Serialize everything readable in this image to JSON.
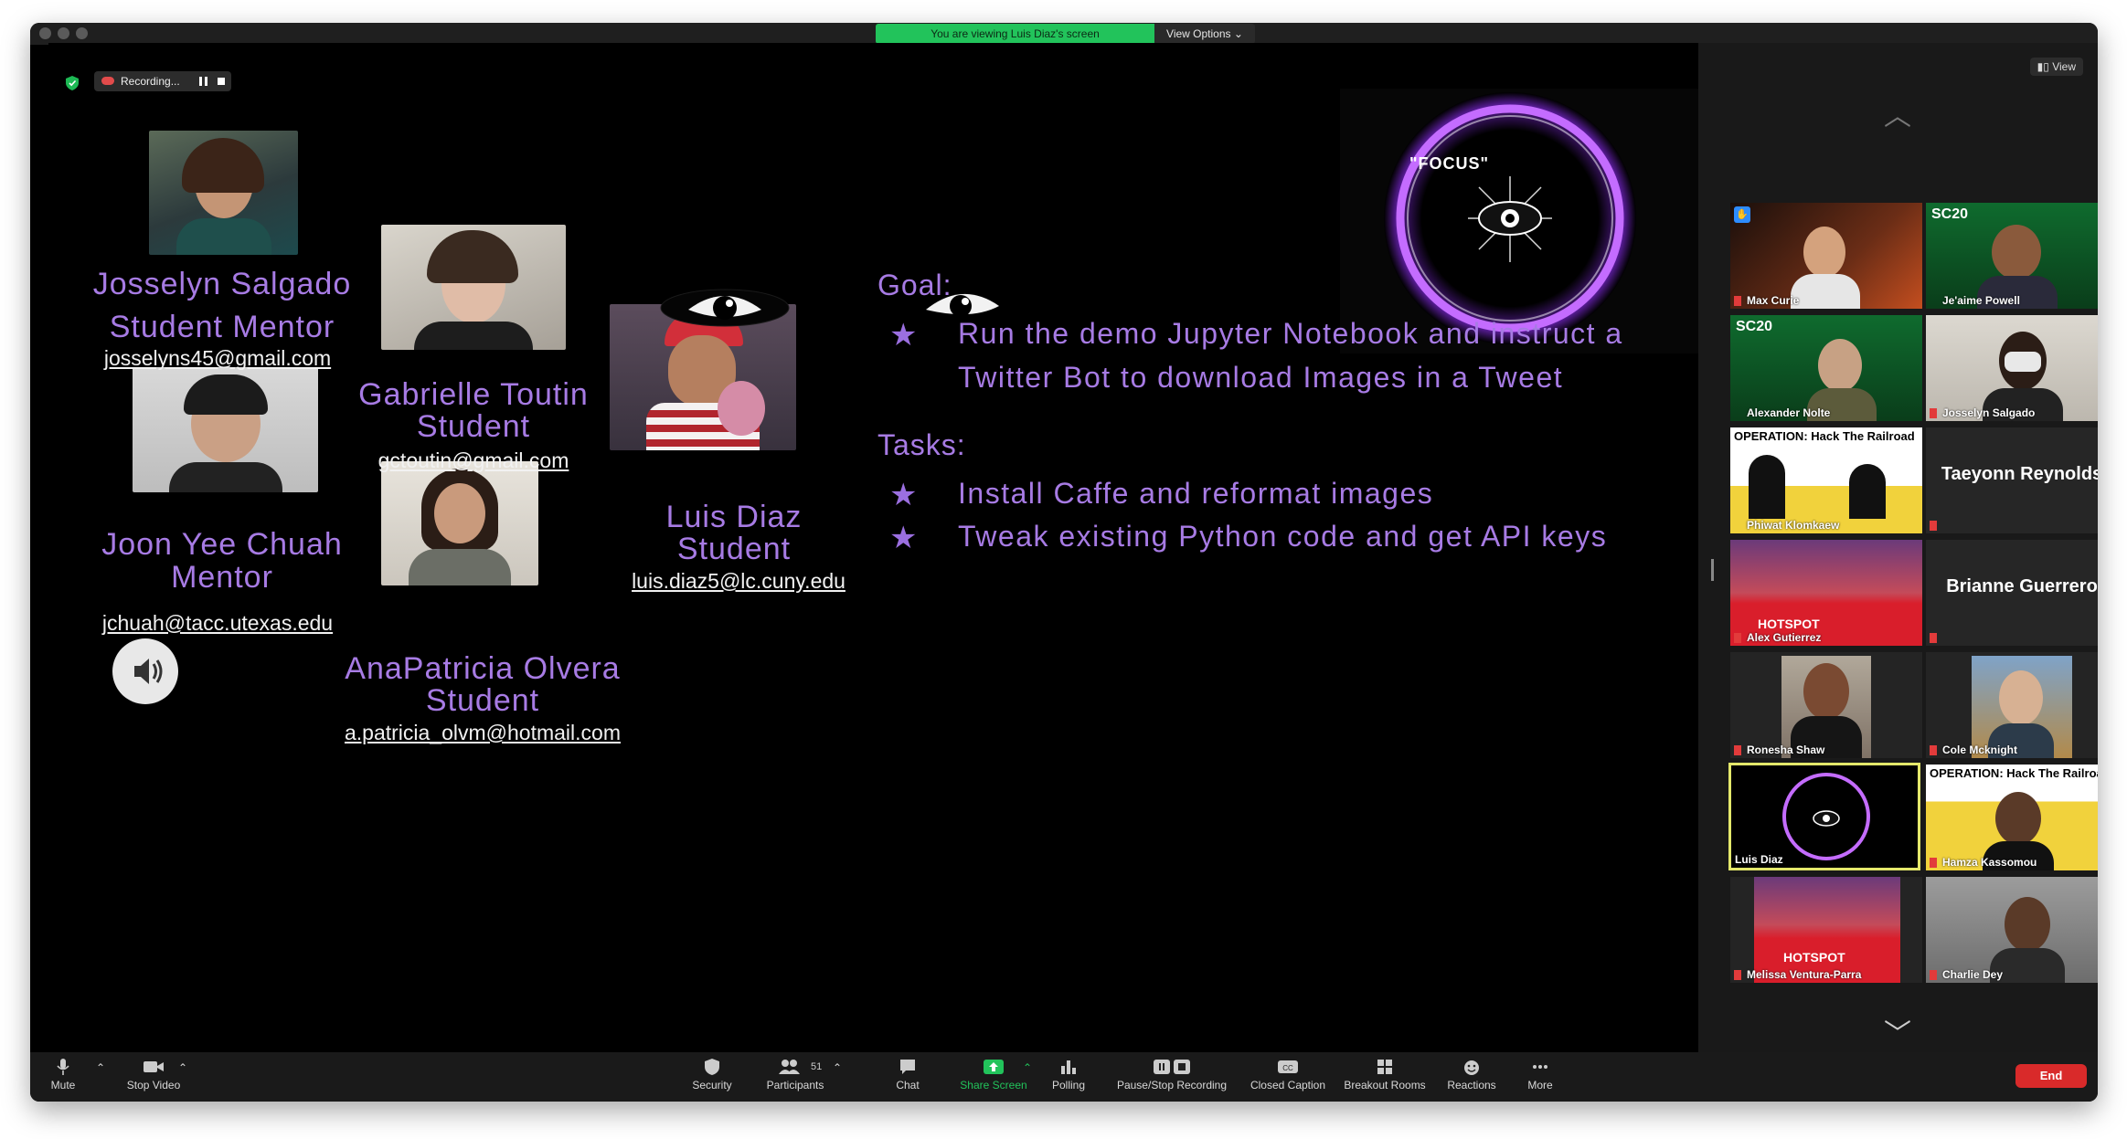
{
  "banner": {
    "viewing": "You are viewing Luis Diaz's screen",
    "view_options": "View Options"
  },
  "recording": {
    "label": "Recording..."
  },
  "view_button": "View",
  "slide": {
    "people": [
      {
        "name": "Josselyn Salgado",
        "role": "Student Mentor",
        "email": "josselyns45@gmail.com"
      },
      {
        "name": "Gabrielle Toutin",
        "role": "Student",
        "email": "gctoutin@gmail.com"
      },
      {
        "name": "Luis Diaz",
        "role": "Student",
        "email": "luis.diaz5@lc.cuny.edu"
      },
      {
        "name": "Joon Yee Chuah",
        "role": "Mentor",
        "email": "jchuah@tacc.utexas.edu"
      },
      {
        "name": "AnaPatricia Olvera",
        "role": "Student",
        "email": "a.patricia_olvm@hotmail.com"
      }
    ],
    "goal_heading": "Goal:",
    "goal_lines": [
      "Run the demo Jupyter Notebook and instruct a",
      "Twitter  Bot to download Images in a Tweet"
    ],
    "tasks_heading": "Tasks:",
    "tasks": [
      "Install Caffe and reformat images",
      "Tweak  existing Python code and get API keys"
    ],
    "focus_label": "\"FOCUS\""
  },
  "gallery": [
    {
      "name": "Max Curie"
    },
    {
      "name": "Je'aime Powell"
    },
    {
      "name": "Alexander Nolte"
    },
    {
      "name": "Josselyn Salgado"
    },
    {
      "name": "Phiwat Klomkaew"
    },
    {
      "name": "Taeyonn Reynolds"
    },
    {
      "name": "Alex Gutierrez"
    },
    {
      "name": "Brianne Guerrero"
    },
    {
      "name": "Ronesha Shaw"
    },
    {
      "name": "Cole Mcknight"
    },
    {
      "name": "Luis Diaz"
    },
    {
      "name": "Hamza Kassomou"
    },
    {
      "name": "Melissa Ventura-Parra"
    },
    {
      "name": "Charlie Dey"
    }
  ],
  "toolbar": {
    "mute": "Mute",
    "stop_video": "Stop Video",
    "security": "Security",
    "participants": "Participants",
    "participants_count": "51",
    "chat": "Chat",
    "share_screen": "Share Screen",
    "polling": "Polling",
    "pause_stop_recording": "Pause/Stop Recording",
    "closed_caption": "Closed Caption",
    "breakout_rooms": "Breakout Rooms",
    "reactions": "Reactions",
    "more": "More",
    "end": "End"
  },
  "colors": {
    "accent_purple": "#a77be4",
    "zoom_green": "#22c35b",
    "end_red": "#d92a2a",
    "speaker_highlight": "#e4e86b"
  }
}
